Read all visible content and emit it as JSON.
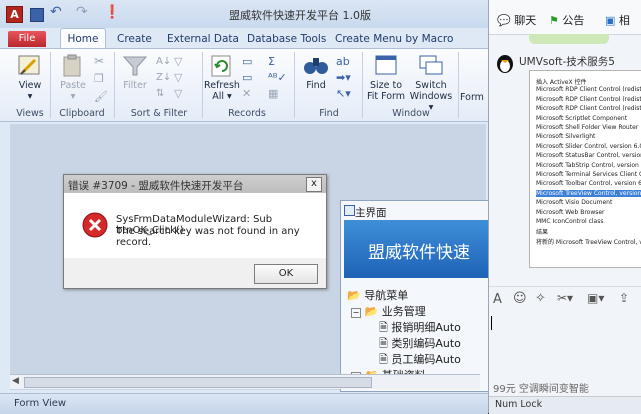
{
  "app": {
    "title": "盟威软件快速开发平台 1.0版",
    "icon_letter": "A"
  },
  "tabs": [
    "File",
    "Home",
    "Create",
    "External Data",
    "Database Tools",
    "Create Menu by Macro"
  ],
  "ribbon": {
    "groups": {
      "views": {
        "label": "Views",
        "buttons": [
          "View"
        ]
      },
      "clipboard": {
        "label": "Clipboard",
        "buttons": [
          "Paste"
        ]
      },
      "sort_filter": {
        "label": "Sort & Filter",
        "buttons": [
          "Filter"
        ]
      },
      "records": {
        "label": "Records",
        "buttons": [
          "Refresh",
          "All"
        ]
      },
      "find": {
        "label": "Find",
        "buttons": [
          "Find"
        ]
      },
      "window": {
        "label": "Window",
        "buttons": [
          "Size to",
          "Fit Form",
          "Switch",
          "Windows"
        ]
      },
      "text_formatting": {
        "label": "Form"
      }
    }
  },
  "status": {
    "left": "Form View",
    "right": "Num Lock"
  },
  "dialog": {
    "title": "错误 #3709 - 盟威软件快速开发平台",
    "close": "x",
    "line1": "SysFrmDataModuleWizard: Sub btnOK_Click()",
    "line2": "The search key was not found in any record.",
    "ok": "OK"
  },
  "main_form": {
    "title": "主界面",
    "banner": "盟威软件快速",
    "tree": {
      "root": "导航菜单",
      "group1": "业务管理",
      "items": [
        "报销明细Auto",
        "类别编码Auto",
        "员工编码Auto"
      ],
      "group2": "基础资料"
    }
  },
  "chat": {
    "tabs": [
      "聊天",
      "公告",
      "相"
    ],
    "user": "UMVsoft-技术服务5",
    "screenshot_lines": [
      "插入 ActiveX 控件",
      "Microsoft RDP Client Control (redistributable)",
      "Microsoft RDP Client Control (redistributable)",
      "Microsoft RDP Client Control (redistributable)",
      "Microsoft Scriptlet Component",
      "Microsoft Shell Folder View Router",
      "Microsoft Silverlight",
      "Microsoft Slider Control, version 6.0",
      "Microsoft StatusBar Control, version 6.0",
      "Microsoft TabStrip Control, version 6.0",
      "Microsoft Terminal Services Client Control",
      "Microsoft Toolbar Control, version 6.0",
      "Microsoft TreeView Control, version 6.0",
      "Microsoft Visio Document",
      "Microsoft Web Browser",
      "MMC IconControl class",
      "结果",
      "将新的 Microsoft TreeView Control, version"
    ],
    "footer": "99元 空调瞬间变智能"
  }
}
